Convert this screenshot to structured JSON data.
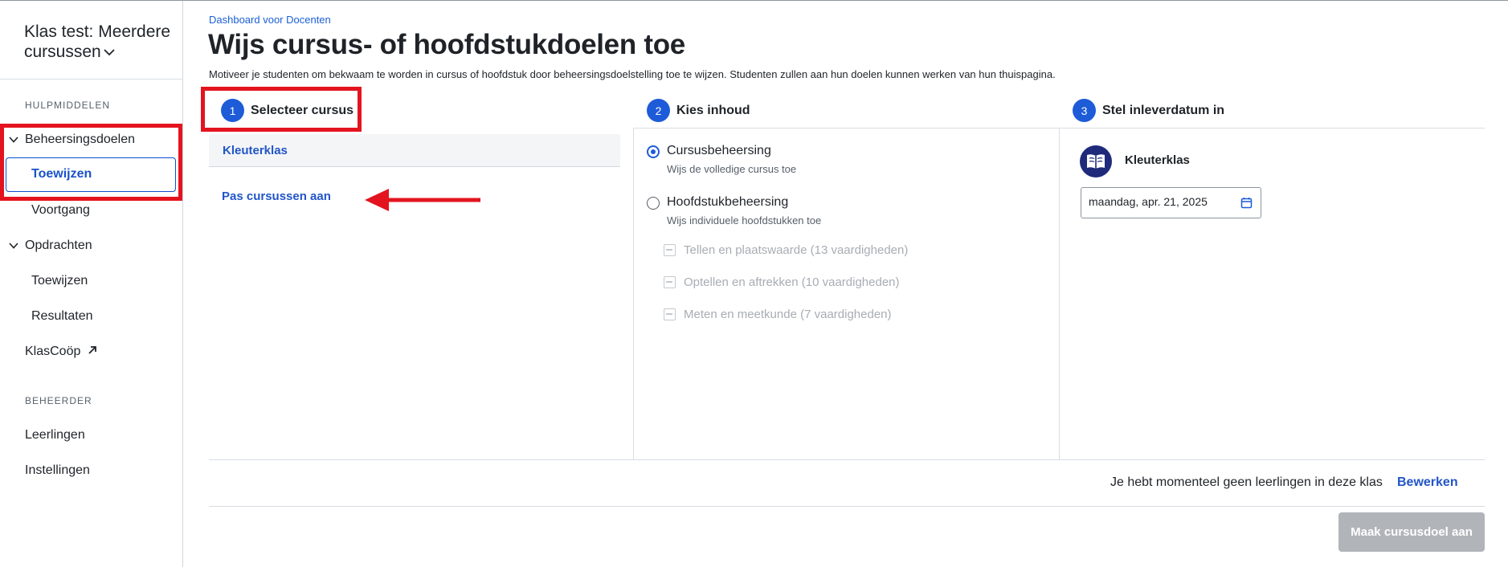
{
  "sidebar": {
    "class_title": "Klas test: Meerdere cursussen",
    "sections": {
      "tools": "HULPMIDDELEN",
      "admin": "BEHEERDER"
    },
    "mastery_group": "Beheersingsdoelen",
    "mastery_items": [
      "Toewijzen",
      "Voortgang"
    ],
    "assignments_group": "Opdrachten",
    "assignments_items": [
      "Toewijzen",
      "Resultaten"
    ],
    "klascoop": "KlasCoöp",
    "admin_items": [
      "Leerlingen",
      "Instellingen"
    ]
  },
  "header": {
    "breadcrumb": "Dashboard voor Docenten",
    "title": "Wijs cursus- of hoofdstukdoelen toe",
    "description": "Motiveer je studenten om bekwaam te worden in cursus of hoofdstuk door beheersingsdoelstelling toe te wijzen. Studenten zullen aan hun doelen kunnen werken van hun thuispagina."
  },
  "steps": [
    {
      "num": "1",
      "label": "Selecteer cursus"
    },
    {
      "num": "2",
      "label": "Kies inhoud"
    },
    {
      "num": "3",
      "label": "Stel inleverdatum in"
    }
  ],
  "course_select": {
    "selected_course": "Kleuterklas",
    "adjust_link": "Pas cursussen aan"
  },
  "content_choice": {
    "options": [
      {
        "title": "Cursusbeheersing",
        "subtitle": "Wijs de volledige cursus toe",
        "checked": true
      },
      {
        "title": "Hoofdstukbeheersing",
        "subtitle": "Wijs individuele hoofdstukken toe",
        "checked": false
      }
    ],
    "chapters": [
      "Tellen en plaatswaarde (13 vaardigheden)",
      "Optellen en aftrekken (10 vaardigheden)",
      "Meten en meetkunde (7 vaardigheden)"
    ]
  },
  "due_date": {
    "course": "Kleuterklas",
    "date_value": "maandag, apr. 21, 2025"
  },
  "footer": {
    "no_students_text": "Je hebt momenteel geen leerlingen in deze klas",
    "edit_link": "Bewerken",
    "create_button": "Maak cursusdoel aan"
  },
  "colors": {
    "accent": "#1d5bd8",
    "link": "#2155c8",
    "annotation_red": "#e3141f",
    "disabled_button": "#b1b4b8"
  }
}
